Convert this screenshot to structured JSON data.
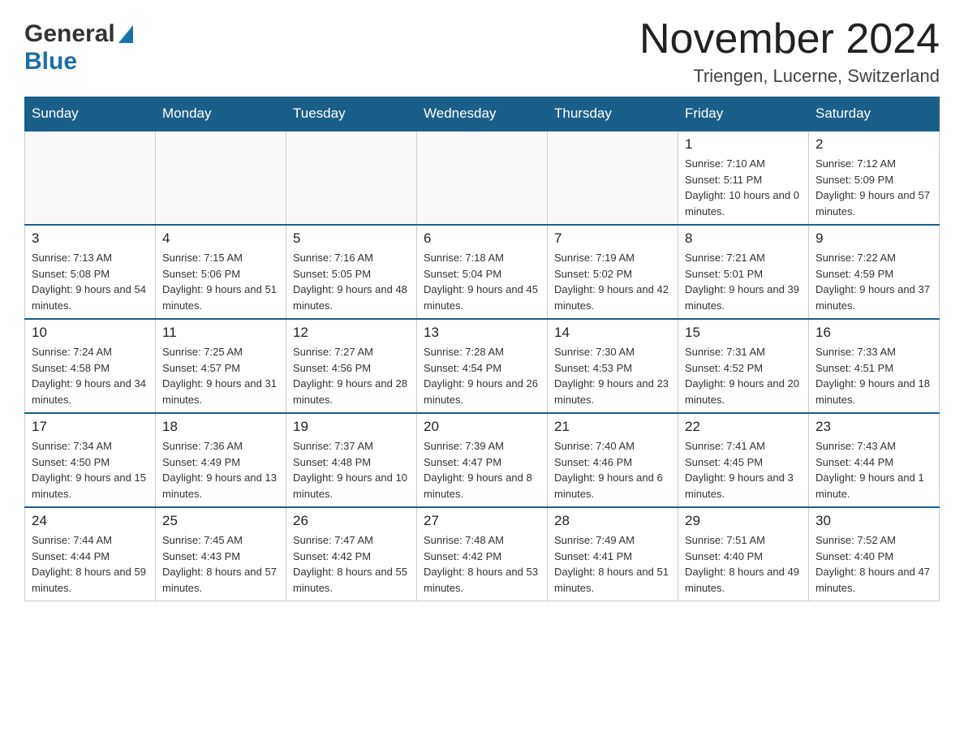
{
  "header": {
    "logo_general": "General",
    "logo_blue": "Blue",
    "month": "November 2024",
    "location": "Triengen, Lucerne, Switzerland"
  },
  "weekdays": [
    "Sunday",
    "Monday",
    "Tuesday",
    "Wednesday",
    "Thursday",
    "Friday",
    "Saturday"
  ],
  "weeks": [
    [
      {
        "day": "",
        "sunrise": "",
        "sunset": "",
        "daylight": ""
      },
      {
        "day": "",
        "sunrise": "",
        "sunset": "",
        "daylight": ""
      },
      {
        "day": "",
        "sunrise": "",
        "sunset": "",
        "daylight": ""
      },
      {
        "day": "",
        "sunrise": "",
        "sunset": "",
        "daylight": ""
      },
      {
        "day": "",
        "sunrise": "",
        "sunset": "",
        "daylight": ""
      },
      {
        "day": "1",
        "sunrise": "Sunrise: 7:10 AM",
        "sunset": "Sunset: 5:11 PM",
        "daylight": "Daylight: 10 hours and 0 minutes."
      },
      {
        "day": "2",
        "sunrise": "Sunrise: 7:12 AM",
        "sunset": "Sunset: 5:09 PM",
        "daylight": "Daylight: 9 hours and 57 minutes."
      }
    ],
    [
      {
        "day": "3",
        "sunrise": "Sunrise: 7:13 AM",
        "sunset": "Sunset: 5:08 PM",
        "daylight": "Daylight: 9 hours and 54 minutes."
      },
      {
        "day": "4",
        "sunrise": "Sunrise: 7:15 AM",
        "sunset": "Sunset: 5:06 PM",
        "daylight": "Daylight: 9 hours and 51 minutes."
      },
      {
        "day": "5",
        "sunrise": "Sunrise: 7:16 AM",
        "sunset": "Sunset: 5:05 PM",
        "daylight": "Daylight: 9 hours and 48 minutes."
      },
      {
        "day": "6",
        "sunrise": "Sunrise: 7:18 AM",
        "sunset": "Sunset: 5:04 PM",
        "daylight": "Daylight: 9 hours and 45 minutes."
      },
      {
        "day": "7",
        "sunrise": "Sunrise: 7:19 AM",
        "sunset": "Sunset: 5:02 PM",
        "daylight": "Daylight: 9 hours and 42 minutes."
      },
      {
        "day": "8",
        "sunrise": "Sunrise: 7:21 AM",
        "sunset": "Sunset: 5:01 PM",
        "daylight": "Daylight: 9 hours and 39 minutes."
      },
      {
        "day": "9",
        "sunrise": "Sunrise: 7:22 AM",
        "sunset": "Sunset: 4:59 PM",
        "daylight": "Daylight: 9 hours and 37 minutes."
      }
    ],
    [
      {
        "day": "10",
        "sunrise": "Sunrise: 7:24 AM",
        "sunset": "Sunset: 4:58 PM",
        "daylight": "Daylight: 9 hours and 34 minutes."
      },
      {
        "day": "11",
        "sunrise": "Sunrise: 7:25 AM",
        "sunset": "Sunset: 4:57 PM",
        "daylight": "Daylight: 9 hours and 31 minutes."
      },
      {
        "day": "12",
        "sunrise": "Sunrise: 7:27 AM",
        "sunset": "Sunset: 4:56 PM",
        "daylight": "Daylight: 9 hours and 28 minutes."
      },
      {
        "day": "13",
        "sunrise": "Sunrise: 7:28 AM",
        "sunset": "Sunset: 4:54 PM",
        "daylight": "Daylight: 9 hours and 26 minutes."
      },
      {
        "day": "14",
        "sunrise": "Sunrise: 7:30 AM",
        "sunset": "Sunset: 4:53 PM",
        "daylight": "Daylight: 9 hours and 23 minutes."
      },
      {
        "day": "15",
        "sunrise": "Sunrise: 7:31 AM",
        "sunset": "Sunset: 4:52 PM",
        "daylight": "Daylight: 9 hours and 20 minutes."
      },
      {
        "day": "16",
        "sunrise": "Sunrise: 7:33 AM",
        "sunset": "Sunset: 4:51 PM",
        "daylight": "Daylight: 9 hours and 18 minutes."
      }
    ],
    [
      {
        "day": "17",
        "sunrise": "Sunrise: 7:34 AM",
        "sunset": "Sunset: 4:50 PM",
        "daylight": "Daylight: 9 hours and 15 minutes."
      },
      {
        "day": "18",
        "sunrise": "Sunrise: 7:36 AM",
        "sunset": "Sunset: 4:49 PM",
        "daylight": "Daylight: 9 hours and 13 minutes."
      },
      {
        "day": "19",
        "sunrise": "Sunrise: 7:37 AM",
        "sunset": "Sunset: 4:48 PM",
        "daylight": "Daylight: 9 hours and 10 minutes."
      },
      {
        "day": "20",
        "sunrise": "Sunrise: 7:39 AM",
        "sunset": "Sunset: 4:47 PM",
        "daylight": "Daylight: 9 hours and 8 minutes."
      },
      {
        "day": "21",
        "sunrise": "Sunrise: 7:40 AM",
        "sunset": "Sunset: 4:46 PM",
        "daylight": "Daylight: 9 hours and 6 minutes."
      },
      {
        "day": "22",
        "sunrise": "Sunrise: 7:41 AM",
        "sunset": "Sunset: 4:45 PM",
        "daylight": "Daylight: 9 hours and 3 minutes."
      },
      {
        "day": "23",
        "sunrise": "Sunrise: 7:43 AM",
        "sunset": "Sunset: 4:44 PM",
        "daylight": "Daylight: 9 hours and 1 minute."
      }
    ],
    [
      {
        "day": "24",
        "sunrise": "Sunrise: 7:44 AM",
        "sunset": "Sunset: 4:44 PM",
        "daylight": "Daylight: 8 hours and 59 minutes."
      },
      {
        "day": "25",
        "sunrise": "Sunrise: 7:45 AM",
        "sunset": "Sunset: 4:43 PM",
        "daylight": "Daylight: 8 hours and 57 minutes."
      },
      {
        "day": "26",
        "sunrise": "Sunrise: 7:47 AM",
        "sunset": "Sunset: 4:42 PM",
        "daylight": "Daylight: 8 hours and 55 minutes."
      },
      {
        "day": "27",
        "sunrise": "Sunrise: 7:48 AM",
        "sunset": "Sunset: 4:42 PM",
        "daylight": "Daylight: 8 hours and 53 minutes."
      },
      {
        "day": "28",
        "sunrise": "Sunrise: 7:49 AM",
        "sunset": "Sunset: 4:41 PM",
        "daylight": "Daylight: 8 hours and 51 minutes."
      },
      {
        "day": "29",
        "sunrise": "Sunrise: 7:51 AM",
        "sunset": "Sunset: 4:40 PM",
        "daylight": "Daylight: 8 hours and 49 minutes."
      },
      {
        "day": "30",
        "sunrise": "Sunrise: 7:52 AM",
        "sunset": "Sunset: 4:40 PM",
        "daylight": "Daylight: 8 hours and 47 minutes."
      }
    ]
  ]
}
